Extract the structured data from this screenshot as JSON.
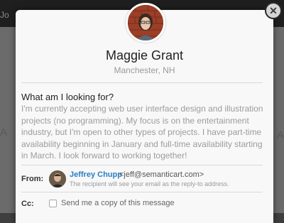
{
  "background": {
    "topbar_text": "Jo"
  },
  "modal": {
    "close_label": "✕",
    "profile": {
      "name": "Maggie Grant",
      "location": "Manchester, NH"
    },
    "section": {
      "title": "What am I looking for?",
      "body": "I'm currently accepting web user interface design and illustration projects (no programming). My focus is on the entertainment industry, but I'm open to other types of projects. I have part-time availability beginning in January and full-time availability starting in March. I look forward to working together!"
    },
    "from": {
      "label": "From:",
      "sender_name": "Jeffrey Chupp",
      "sender_email": "<jeff@semanticart.com>",
      "note": "The recipient will see your email as the reply-to address."
    },
    "cc": {
      "label": "Cc:",
      "checkbox_label": "Send me a copy of this message"
    }
  },
  "colors": {
    "link": "#2a7ec4",
    "muted_text": "#9c9c9c",
    "modal_bg": "#f8f8f8"
  }
}
